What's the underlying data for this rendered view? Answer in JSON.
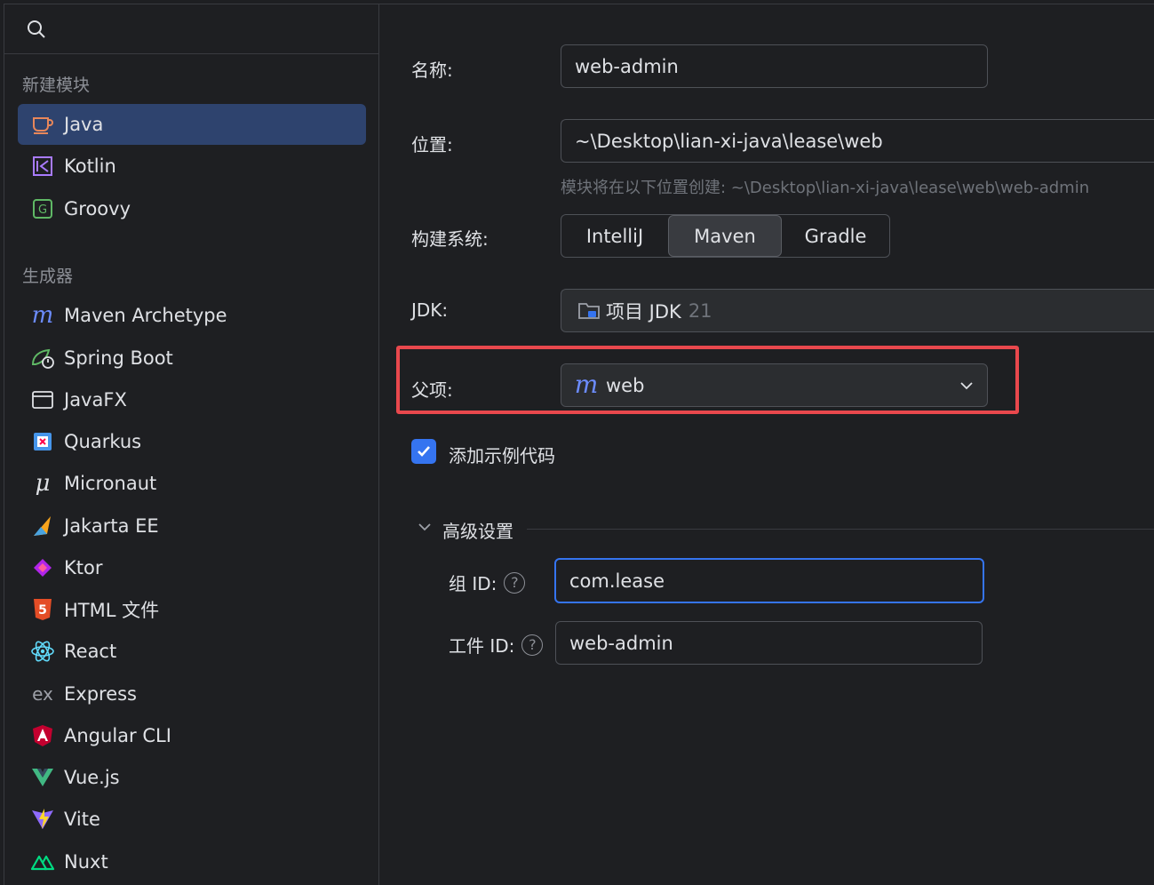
{
  "sidebar": {
    "new_module_header": "新建模块",
    "generators_header": "生成器",
    "modules": [
      {
        "label": "Java",
        "icon": "java-icon",
        "selected": true
      },
      {
        "label": "Kotlin",
        "icon": "kotlin-icon"
      },
      {
        "label": "Groovy",
        "icon": "groovy-icon"
      }
    ],
    "generators": [
      {
        "label": "Maven Archetype",
        "icon": "maven-icon"
      },
      {
        "label": "Spring Boot",
        "icon": "spring-boot-icon"
      },
      {
        "label": "JavaFX",
        "icon": "javafx-icon"
      },
      {
        "label": "Quarkus",
        "icon": "quarkus-icon"
      },
      {
        "label": "Micronaut",
        "icon": "micronaut-icon"
      },
      {
        "label": "Jakarta EE",
        "icon": "jakarta-ee-icon"
      },
      {
        "label": "Ktor",
        "icon": "ktor-icon"
      },
      {
        "label": "HTML 文件",
        "icon": "html-icon"
      },
      {
        "label": "React",
        "icon": "react-icon"
      },
      {
        "label": "Express",
        "icon": "express-icon"
      },
      {
        "label": "Angular CLI",
        "icon": "angular-icon"
      },
      {
        "label": "Vue.js",
        "icon": "vue-icon"
      },
      {
        "label": "Vite",
        "icon": "vite-icon"
      },
      {
        "label": "Nuxt",
        "icon": "nuxt-icon"
      }
    ]
  },
  "form": {
    "name_label": "名称:",
    "name_value": "web-admin",
    "location_label": "位置:",
    "location_value": "~\\Desktop\\lian-xi-java\\lease\\web",
    "location_hint": "模块将在以下位置创建: ~\\Desktop\\lian-xi-java\\lease\\web\\web-admin",
    "build_label": "构建系统:",
    "build_options": [
      "IntelliJ",
      "Maven",
      "Gradle"
    ],
    "build_selected": "Maven",
    "jdk_label": "JDK:",
    "jdk_value": "项目 JDK",
    "jdk_version": "21",
    "parent_label": "父项:",
    "parent_value": "web",
    "sample_code_label": "添加示例代码",
    "sample_code_checked": true,
    "advanced_label": "高级设置",
    "group_id_label": "组 ID:",
    "group_id_value": "com.lease",
    "artifact_id_label": "工件 ID:",
    "artifact_id_value": "web-admin"
  },
  "colors": {
    "accent": "#3574f0",
    "highlight": "#e9484d",
    "selection": "#2e436e",
    "background": "#1e1f22"
  }
}
